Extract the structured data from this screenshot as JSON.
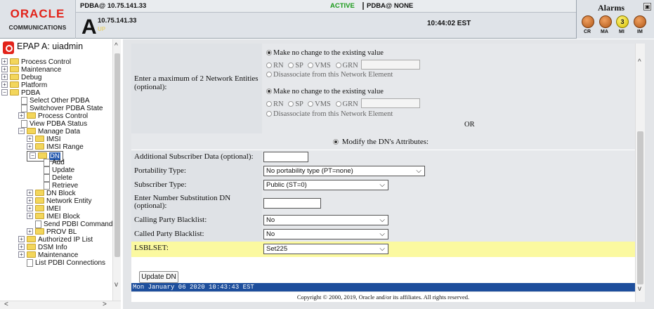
{
  "header": {
    "logo_top": "ORACLE",
    "logo_bottom": "COMMUNICATIONS",
    "status_left": "PDBA@ 10.75.141.33",
    "status_active": "ACTIVE",
    "status_right": "PDBA@ NONE",
    "server_letter": "A",
    "server_ip": "10.75.141.33",
    "server_state": "UP",
    "clock": "10:44:02 EST"
  },
  "alarms": {
    "title": "Alarms",
    "labels": [
      "CR",
      "MA",
      "MI",
      "IM"
    ],
    "mi_count": "3"
  },
  "nav": {
    "title": "EPAP A: uiadmin",
    "items": [
      {
        "label": "Process Control"
      },
      {
        "label": "Maintenance"
      },
      {
        "label": "Debug"
      },
      {
        "label": "Platform"
      },
      {
        "label": "PDBA"
      },
      {
        "label": "Select Other PDBA"
      },
      {
        "label": "Switchover PDBA State"
      },
      {
        "label": "Process Control"
      },
      {
        "label": "View PDBA Status"
      },
      {
        "label": "Manage Data"
      },
      {
        "label": "IMSI"
      },
      {
        "label": "IMSI Range"
      },
      {
        "label": "DN"
      },
      {
        "label": "Add"
      },
      {
        "label": "Update"
      },
      {
        "label": "Delete"
      },
      {
        "label": "Retrieve"
      },
      {
        "label": "DN Block"
      },
      {
        "label": "Network Entity"
      },
      {
        "label": "IMEI"
      },
      {
        "label": "IMEI Block"
      },
      {
        "label": "Send PDBI Command"
      },
      {
        "label": "PROV BL"
      },
      {
        "label": "Authorized IP List"
      },
      {
        "label": "DSM Info"
      },
      {
        "label": "Maintenance"
      },
      {
        "label": "List PDBI Connections"
      }
    ]
  },
  "form": {
    "ne_label": "Enter a maximum of 2 Network Entities (optional):",
    "opt_nochange": "Make no change to the existing value",
    "opt_rn": "RN",
    "opt_sp": "SP",
    "opt_vms": "VMS",
    "opt_grn": "GRN",
    "opt_disassociate": "Disassociate from this Network Element",
    "or_text": "OR",
    "modify_text": "Modify the DN's Attributes:",
    "additional_label": "Additional Subscriber Data (optional):",
    "portability_label": "Portability Type:",
    "portability_value": "No portability type (PT=none)",
    "subscriber_label": "Subscriber Type:",
    "subscriber_value": "Public (ST=0)",
    "nsdn_label": "Enter Number Substitution DN (optional):",
    "calling_label": "Calling Party Blacklist:",
    "calling_value": "No",
    "called_label": "Called Party Blacklist:",
    "called_value": "No",
    "lsblset_label": "LSBLSET:",
    "lsblset_value": "Set225",
    "update_button": "Update DN"
  },
  "statusbar": {
    "text": "Mon January 06 2020 10:43:43 EST"
  },
  "footer": {
    "copyright": "Copyright © 2000, 2019, Oracle and/or its affiliates. All rights reserved."
  }
}
